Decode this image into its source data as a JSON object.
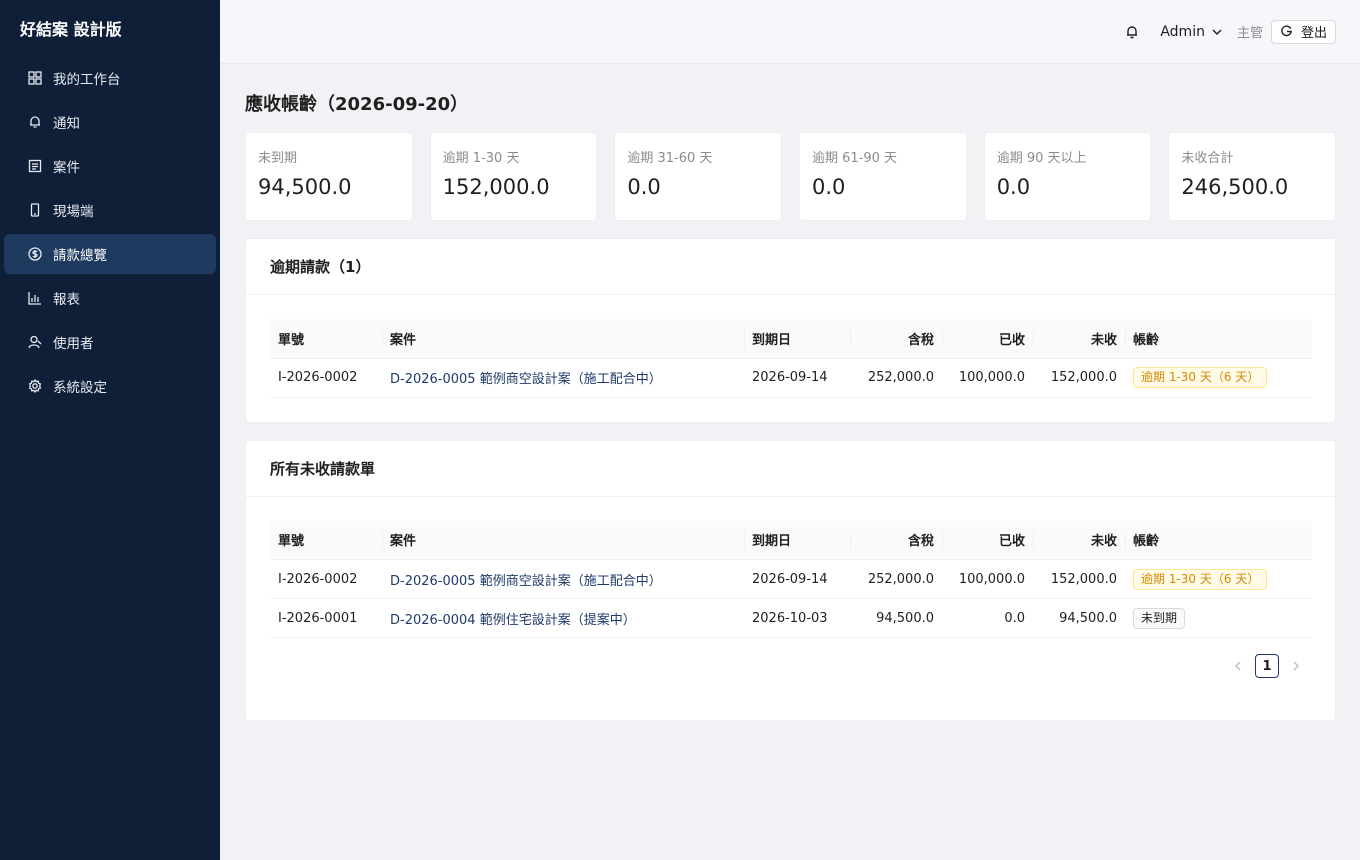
{
  "app": {
    "title": "好結案 設計版"
  },
  "sidebar": {
    "items": [
      {
        "label": "我的工作台",
        "icon": "dashboard-icon",
        "active": false
      },
      {
        "label": "通知",
        "icon": "bell-icon",
        "active": false
      },
      {
        "label": "案件",
        "icon": "case-icon",
        "active": false
      },
      {
        "label": "現場端",
        "icon": "mobile-icon",
        "active": false
      },
      {
        "label": "請款總覽",
        "icon": "dollar-icon",
        "active": true
      },
      {
        "label": "報表",
        "icon": "bar-chart-icon",
        "active": false
      },
      {
        "label": "使用者",
        "icon": "user-icon",
        "active": false
      },
      {
        "label": "系統設定",
        "icon": "gear-icon",
        "active": false
      }
    ]
  },
  "header": {
    "user": "Admin",
    "role": "主管",
    "logout_label": "登出"
  },
  "page": {
    "title": "應收帳齡（2026-09-20）"
  },
  "stats": [
    {
      "label": "未到期",
      "value": "94,500.0"
    },
    {
      "label": "逾期 1-30 天",
      "value": "152,000.0"
    },
    {
      "label": "逾期 31-60 天",
      "value": "0.0"
    },
    {
      "label": "逾期 61-90 天",
      "value": "0.0"
    },
    {
      "label": "逾期 90 天以上",
      "value": "0.0"
    },
    {
      "label": "未收合計",
      "value": "246,500.0"
    }
  ],
  "columns": {
    "number": "單號",
    "case": "案件",
    "due": "到期日",
    "total": "含稅",
    "received": "已收",
    "outstanding": "未收",
    "aging": "帳齡"
  },
  "overdue": {
    "title": "逾期請款（1）",
    "rows": [
      {
        "number": "I-2026-0002",
        "case": "D-2026-0005 範例商空設計案（施工配合中）",
        "due": "2026-09-14",
        "total": "252,000.0",
        "received": "100,000.0",
        "outstanding": "152,000.0",
        "aging": "逾期 1-30 天（6 天）"
      }
    ]
  },
  "unpaid": {
    "title": "所有未收請款單",
    "rows": [
      {
        "number": "I-2026-0002",
        "case": "D-2026-0005 範例商空設計案（施工配合中）",
        "due": "2026-09-14",
        "total": "252,000.0",
        "received": "100,000.0",
        "outstanding": "152,000.0",
        "aging": "逾期 1-30 天（6 天）"
      },
      {
        "number": "I-2026-0001",
        "case": "D-2026-0004 範例住宅設計案（提案中）",
        "due": "2026-10-03",
        "total": "94,500.0",
        "received": "0.0",
        "outstanding": "94,500.0",
        "aging": "未到期"
      }
    ]
  },
  "pagination": {
    "current": "1"
  },
  "colors": {
    "sidebar_bg": "#0f1f38",
    "sidebar_active": "#1f3a5f",
    "link": "#1f3a6a",
    "warning": "#d48806"
  }
}
